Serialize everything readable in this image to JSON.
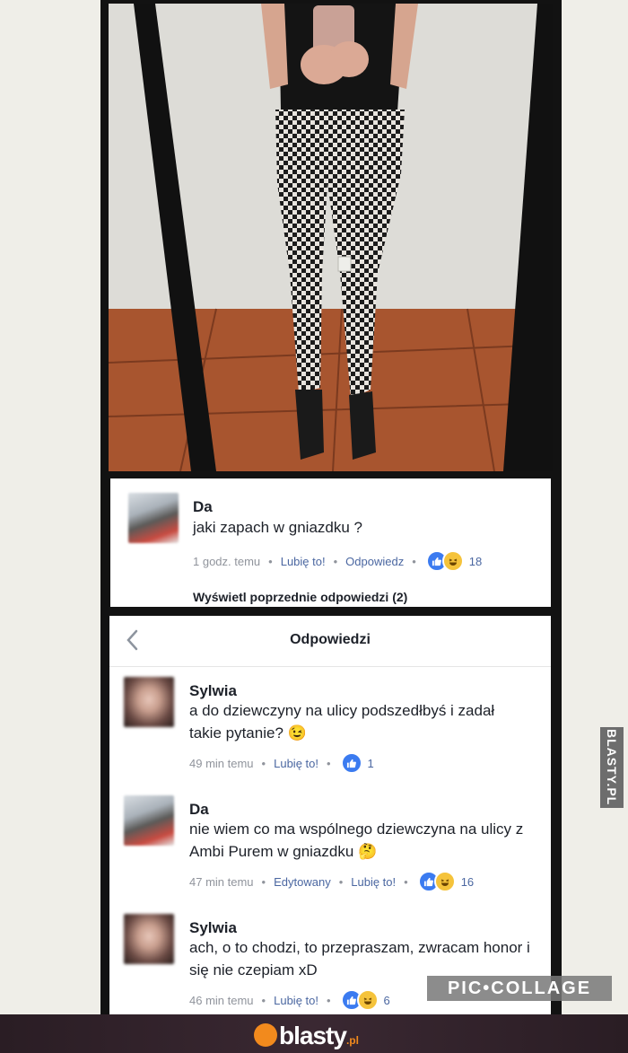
{
  "comment_main": {
    "author": "Da",
    "text": "jaki zapach w gniazdku ?",
    "time": "1 godz. temu",
    "like_label": "Lubię to!",
    "reply_label": "Odpowiedz",
    "reaction_count": "18"
  },
  "view_previous": "Wyświetl poprzednie odpowiedzi (2)",
  "replies_panel": {
    "title": "Odpowiedzi"
  },
  "replies": [
    {
      "author": "Sylwia",
      "text": "a do dziewczyny na ulicy podszedłbyś i zadał takie pytanie? 😉",
      "time": "49 min temu",
      "like_label": "Lubię to!",
      "reaction_count": "1"
    },
    {
      "author": "Da",
      "text": "nie wiem co ma wspólnego dziewczyna na ulicy z Ambi Purem w gniazdku 🤔",
      "time": "47 min temu",
      "edited_label": "Edytowany",
      "like_label": "Lubię to!",
      "reaction_count": "16"
    },
    {
      "author": "Sylwia",
      "text": "ach, o to chodzi, to przepraszam, zwracam honor i się nie czepiam xD",
      "time": "46 min temu",
      "like_label": "Lubię to!",
      "reaction_count": "6"
    }
  ],
  "watermarks": {
    "side_tag": "BLASTY.PL",
    "collage": "PIC•COLLAGE",
    "footer_brand": "blasty",
    "footer_tld": ".pl"
  },
  "colors": {
    "like_blue": "#3b7bf0",
    "link_blue": "#4b67a1",
    "meta_gray": "#90949c",
    "footer_orange": "#f28a1d"
  }
}
